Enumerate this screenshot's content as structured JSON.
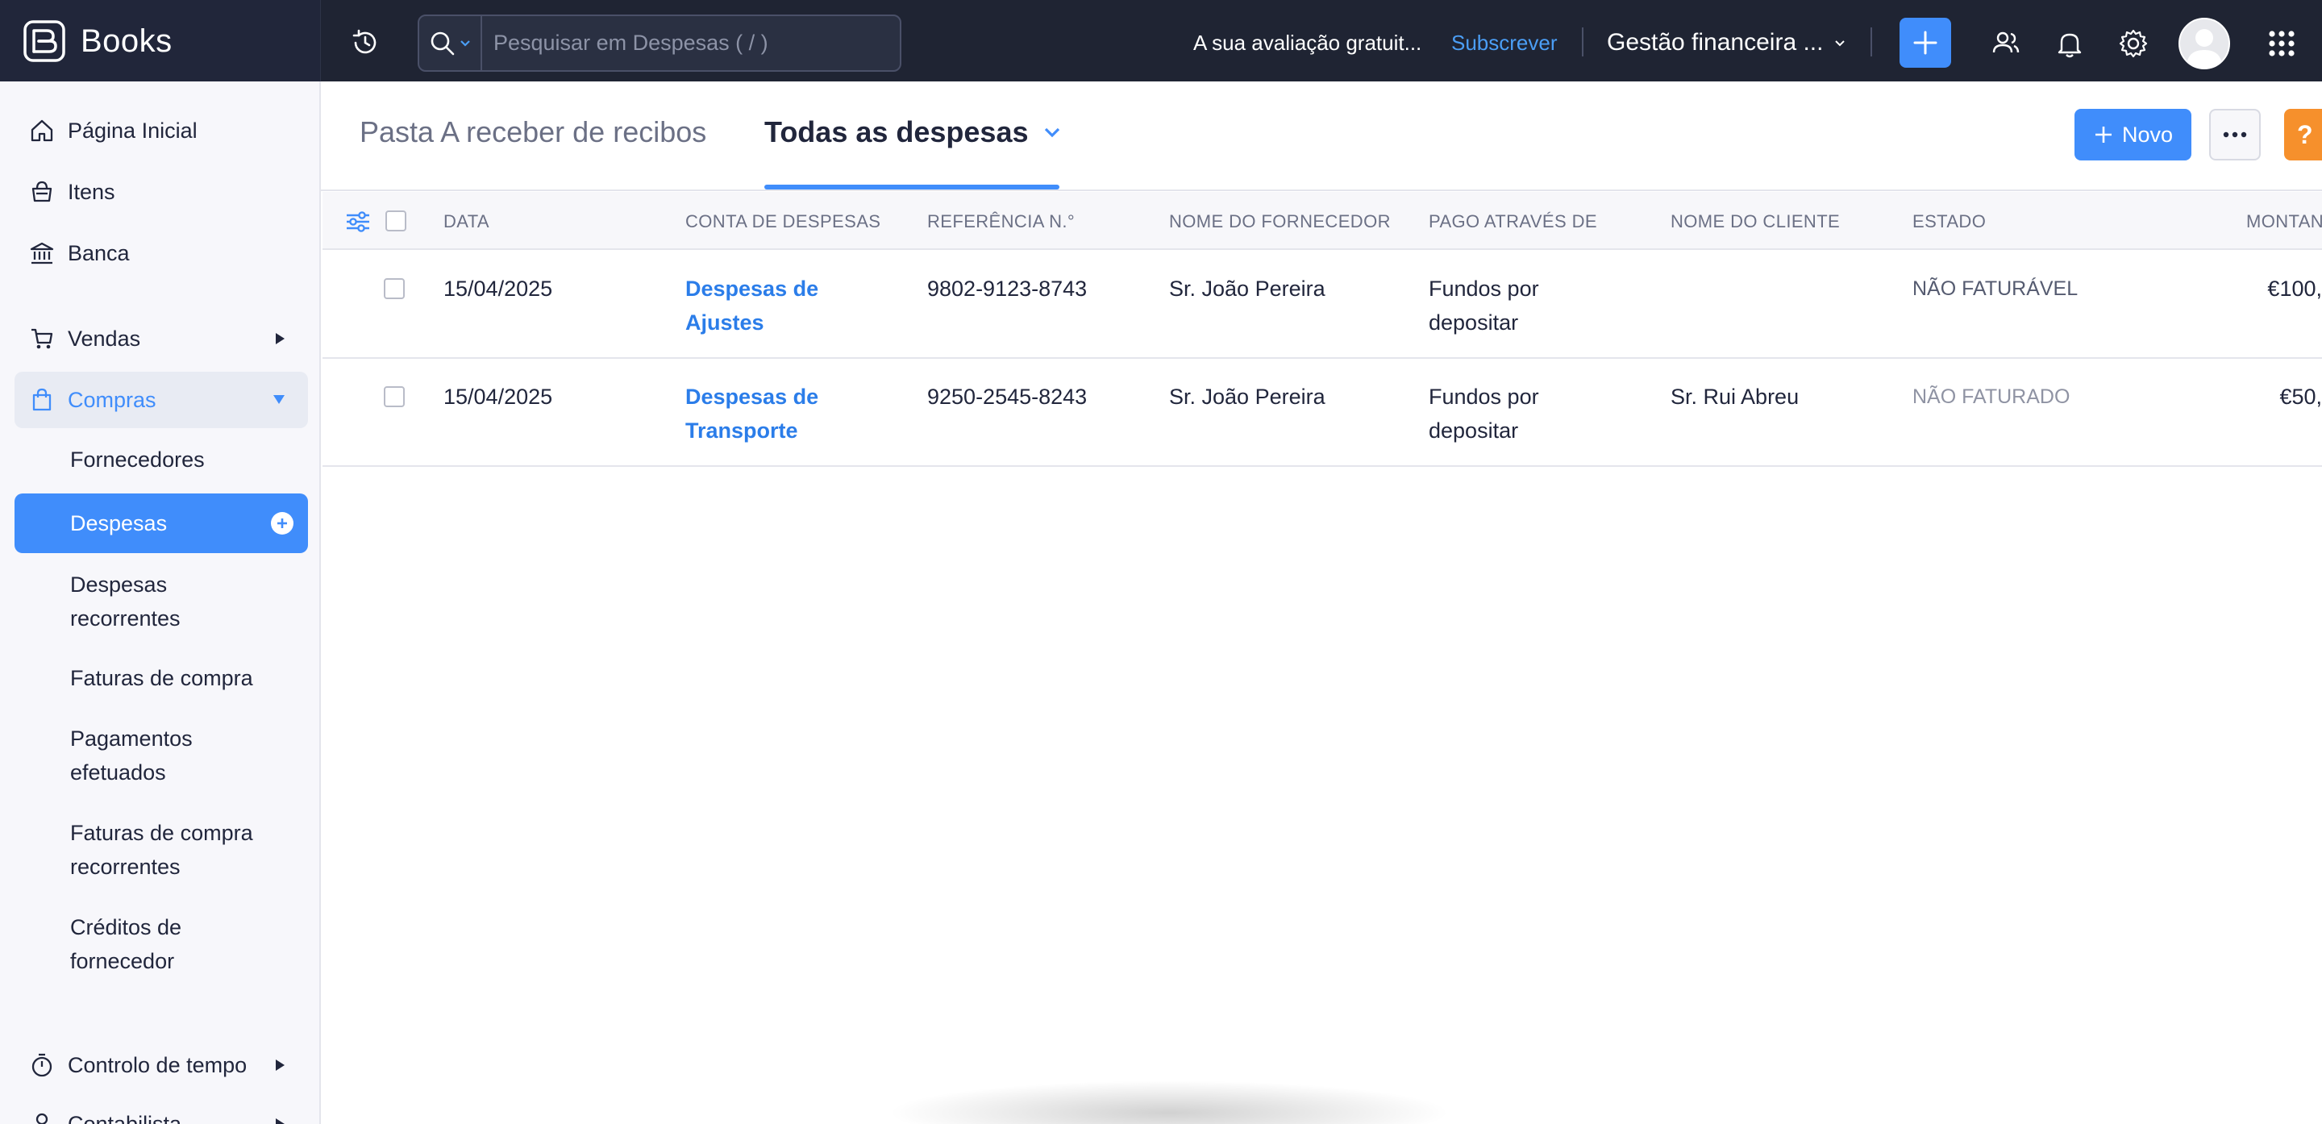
{
  "app": {
    "name": "Books",
    "search_placeholder": "Pesquisar em Despesas ( / )",
    "trial_text": "A sua avaliação gratuit...",
    "subscribe_label": "Subscrever",
    "org_name": "Gestão financeira ...",
    "accent": "#408dfb"
  },
  "sidebar": {
    "top_items": [
      {
        "label": "Página Inicial",
        "icon": "home-icon"
      },
      {
        "label": "Itens",
        "icon": "basket-icon"
      },
      {
        "label": "Banca",
        "icon": "bank-icon"
      }
    ],
    "vendas": {
      "label": "Vendas",
      "icon": "cart-icon"
    },
    "compras": {
      "label": "Compras",
      "icon": "shopping-bag-icon"
    },
    "compras_sub": [
      "Fornecedores",
      "Despesas",
      "Despesas recorrentes",
      "Faturas de compra",
      "Pagamentos efetuados",
      "Faturas de compra recorrentes",
      "Créditos de fornecedor"
    ],
    "tempo": {
      "label": "Controlo de tempo",
      "icon": "stopwatch-icon"
    },
    "contab": {
      "label": "Contabilista",
      "icon": "user-icon"
    }
  },
  "header": {
    "inactive_tab": "Pasta A receber de recibos",
    "active_tab": "Todas as despesas",
    "new_label": "Novo",
    "help_label": "?"
  },
  "table": {
    "columns": [
      "DATA",
      "CONTA DE DESPESAS",
      "REFERÊNCIA N.°",
      "NOME DO FORNECEDOR",
      "PAGO ATRAVÉS DE",
      "NOME DO CLIENTE",
      "ESTADO",
      "MONTAN"
    ],
    "rows": [
      {
        "date": "15/04/2025",
        "account_1": "Despesas de",
        "account_2": "Ajustes",
        "reference": "9802-9123-8743",
        "vendor": "Sr. João Pereira",
        "paid_1": "Fundos por",
        "paid_2": "depositar",
        "customer": "",
        "status": "NÃO FATURÁVEL",
        "amount": "€100,"
      },
      {
        "date": "15/04/2025",
        "account_1": "Despesas de",
        "account_2": "Transporte",
        "reference": "9250-2545-8243",
        "vendor": "Sr. João Pereira",
        "paid_1": "Fundos por",
        "paid_2": "depositar",
        "customer": "Sr. Rui Abreu",
        "status": "NÃO FATURADO",
        "amount": "€50,"
      }
    ]
  }
}
